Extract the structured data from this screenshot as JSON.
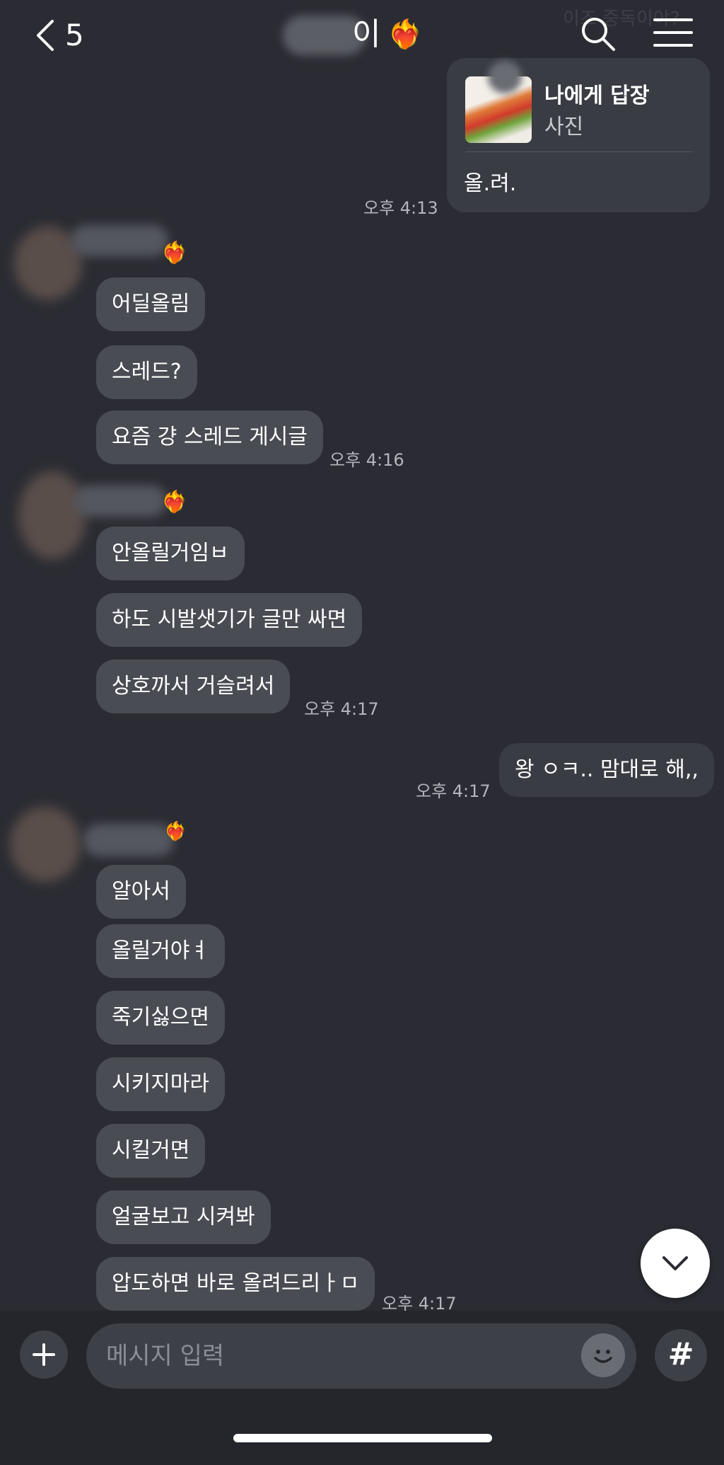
{
  "header": {
    "back_count": "5",
    "title_visible": "이",
    "title_emoji": "❤️‍🔥",
    "faint_text": "이즈 중독이야?",
    "search_icon": "search-icon",
    "menu_icon": "hamburger-menu-icon"
  },
  "reply_card": {
    "title": "나에게 답장",
    "subtitle": "사진",
    "text": "올.려.",
    "time": "오후 4:13"
  },
  "groups": [
    {
      "sender_emoji": "❤️‍🔥",
      "messages": [
        "어딜올림",
        "스레드?",
        "요즘 걍 스레드 게시글"
      ],
      "time": "오후 4:16"
    },
    {
      "sender_emoji": "❤️‍🔥",
      "messages": [
        "안올릴거임ㅂ",
        "하도 시발샛기가 글만 싸면",
        "상호까서 거슬려서"
      ],
      "time": "오후 4:17"
    },
    {
      "sender_emoji": "❤️‍🔥",
      "messages": [
        "알아서",
        "올릴거야ㅕ",
        "죽기싫으면",
        "시키지마라",
        "시킬거면",
        "얼굴보고 시켜봐",
        "압도하면 바로 올려드리ㅏㅁ"
      ],
      "time": "오후 4:17"
    }
  ],
  "my_message": {
    "text": "왕 ㅇㅋ.. 맘대로 해,,",
    "time": "오후 4:17"
  },
  "input": {
    "placeholder": "메시지 입력",
    "value": ""
  },
  "colors": {
    "background": "#2b2c33",
    "bubble": "#4a4c54",
    "input_bar": "#25262c"
  }
}
